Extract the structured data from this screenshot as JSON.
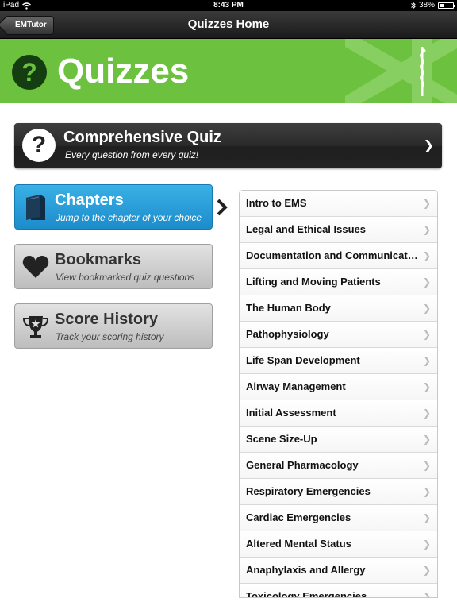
{
  "status_bar": {
    "device": "iPad",
    "time": "8:43 PM",
    "battery": "38%",
    "battery_level": 0.38
  },
  "nav_bar": {
    "back_label": "EMTutor",
    "title": "Quizzes Home"
  },
  "banner": {
    "title": "Quizzes",
    "icon": "question-icon"
  },
  "comprehensive": {
    "title": "Comprehensive Quiz",
    "subtitle": "Every question from every quiz!"
  },
  "menu": {
    "chapters": {
      "title": "Chapters",
      "subtitle": "Jump to the chapter of your choice"
    },
    "bookmarks": {
      "title": "Bookmarks",
      "subtitle": "View bookmarked quiz questions"
    },
    "history": {
      "title": "Score History",
      "subtitle": "Track your scoring history"
    }
  },
  "chapters": [
    "Intro to EMS",
    "Legal and Ethical Issues",
    "Documentation and Communications",
    "Lifting and Moving Patients",
    "The Human Body",
    "Pathophysiology",
    "Life Span Development",
    "Airway Management",
    "Initial Assessment",
    "Scene Size-Up",
    "General Pharmacology",
    "Respiratory Emergencies",
    "Cardiac Emergencies",
    "Altered Mental Status",
    "Anaphylaxis and Allergy",
    "Toxicology Emergencies"
  ],
  "colors": {
    "accent_green": "#6cc13e",
    "accent_blue": "#1c8ccb"
  }
}
